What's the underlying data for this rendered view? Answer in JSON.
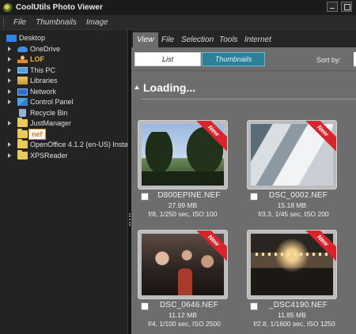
{
  "app": {
    "title": "CoolUtils Photo Viewer"
  },
  "menu": {
    "items": [
      "File",
      "Thumbnails",
      "Image"
    ]
  },
  "tree": {
    "items": [
      {
        "label": "Desktop",
        "icon": "desktop-icon",
        "expandable": false
      },
      {
        "label": "OneDrive",
        "icon": "onedrive-icon",
        "expandable": true
      },
      {
        "label": "LOF",
        "icon": "user-folder-icon",
        "expandable": true,
        "color": "#e8b43a"
      },
      {
        "label": "This PC",
        "icon": "computer-icon",
        "expandable": true
      },
      {
        "label": "Libraries",
        "icon": "libraries-icon",
        "expandable": true
      },
      {
        "label": "Network",
        "icon": "network-icon",
        "expandable": true
      },
      {
        "label": "Control Panel",
        "icon": "control-panel-icon",
        "expandable": true
      },
      {
        "label": "Recycle Bin",
        "icon": "recycle-bin-icon",
        "expandable": false
      },
      {
        "label": "JustManager",
        "icon": "folder-icon",
        "expandable": true
      },
      {
        "label": "nef",
        "icon": "folder-icon",
        "expandable": false,
        "selected": true
      },
      {
        "label": "OpenOffice 4.1.2 (en-US) Insta",
        "icon": "folder-icon",
        "expandable": true
      },
      {
        "label": "XPSReader",
        "icon": "folder-icon",
        "expandable": true
      }
    ]
  },
  "tabs": {
    "items": [
      "View",
      "File",
      "Selection",
      "Tools",
      "Internet"
    ],
    "active": "View"
  },
  "toolbar": {
    "list_label": "List",
    "thumbnails_label": "Thumbnails",
    "sortby_label": "Sort by:"
  },
  "group": {
    "title": "Loading..."
  },
  "badge": {
    "new_label": "New",
    "color": "#d8242c"
  },
  "files": [
    {
      "name": "D800EPINE.NEF",
      "size": "27.99 MB",
      "exif": "f/8, 1/250 sec, ISO 100",
      "photo": "sky"
    },
    {
      "name": "DSC_0002.NEF",
      "size": "15.18 MB",
      "exif": "f/3.3, 1/45 sec, ISO 200",
      "photo": "metal"
    },
    {
      "name": "DSC_0646.NEF",
      "size": "11.12 MB",
      "exif": "f/4, 1/100 sec, ISO 2500",
      "photo": "crowd"
    },
    {
      "name": "_DSC4190.NEF",
      "size": "11.85 MB",
      "exif": "f/2.8, 1/1600 sec, ISO 1250",
      "photo": "hall"
    }
  ],
  "colors": {
    "accent": "#2e7f98",
    "panel": "#6d6d6d",
    "sidebar": "#232323"
  }
}
